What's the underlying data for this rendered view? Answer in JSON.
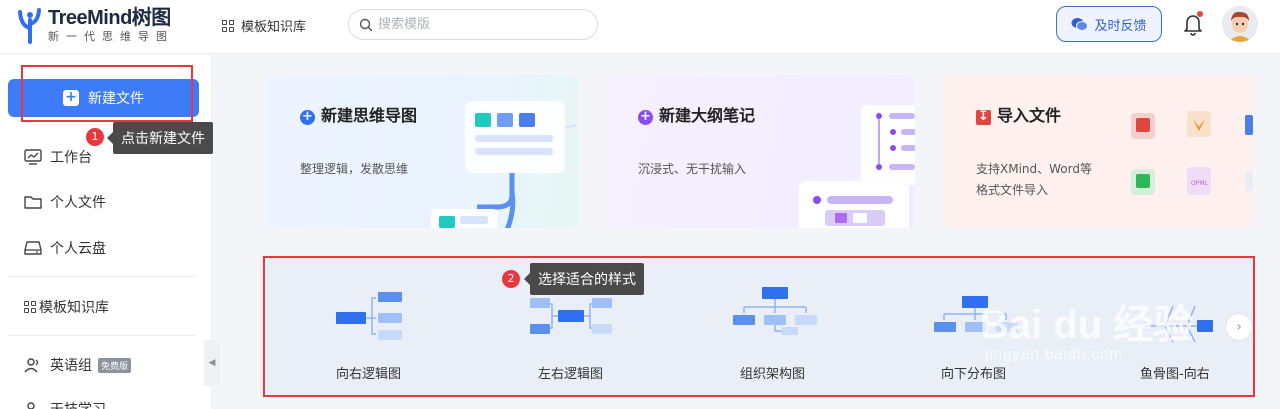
{
  "header": {
    "logo_title": "TreeMind树图",
    "logo_sub": "新一代思维导图",
    "nav_library": "模板知识库",
    "search_placeholder": "搜索模版",
    "feedback_label": "及时反馈"
  },
  "sidebar": {
    "new_file": "新建文件",
    "tip1": "点击新建文件",
    "badge1": "1",
    "items": [
      {
        "label": "工作台",
        "icon": "dashboard-icon"
      },
      {
        "label": "个人文件",
        "icon": "folder-icon"
      },
      {
        "label": "个人云盘",
        "icon": "cloud-drive-icon"
      },
      {
        "label": "模板知识库",
        "icon": "grid-icon"
      },
      {
        "label": "英语组",
        "icon": "users-icon",
        "tag": "免费版"
      },
      {
        "label": "天技学习",
        "icon": "users-icon"
      }
    ]
  },
  "cards": [
    {
      "title": "新建思维导图",
      "desc": "整理逻辑，发散思维",
      "accent": "#2f6ff0"
    },
    {
      "title": "新建大纲笔记",
      "desc": "沉浸式、无干扰输入",
      "accent": "#8a4cf0"
    },
    {
      "title": "导入文件",
      "desc": "支持XMind、Word等格式文件导入",
      "accent": "#e0463f"
    }
  ],
  "templates": {
    "tip2": "选择适合的样式",
    "badge2": "2",
    "items": [
      "向右逻辑图",
      "左右逻辑图",
      "组织架构图",
      "向下分布图",
      "鱼骨图-向右"
    ]
  },
  "watermark": {
    "main": "Bai du 经验",
    "sub": "jingyan.baidu.com"
  }
}
